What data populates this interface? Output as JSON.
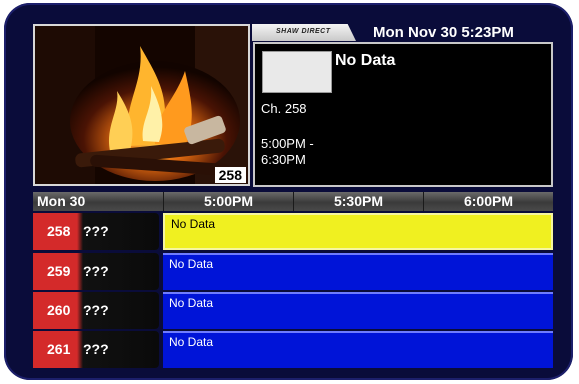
{
  "header": {
    "brand": "SHAW DIRECT",
    "clock": "Mon Nov 30 5:23PM"
  },
  "preview": {
    "channel_tag": "258"
  },
  "info": {
    "title": "No Data",
    "channel": "Ch. 258",
    "time_start": "5:00PM -",
    "time_end": "6:30PM"
  },
  "timebar": {
    "date": "Mon 30",
    "slots": [
      "5:00PM",
      "5:30PM",
      "6:00PM"
    ]
  },
  "rows": [
    {
      "channel": "258",
      "name": "???",
      "program": "No Data",
      "selected": true
    },
    {
      "channel": "259",
      "name": "???",
      "program": "No Data",
      "selected": false
    },
    {
      "channel": "260",
      "name": "???",
      "program": "No Data",
      "selected": false
    },
    {
      "channel": "261",
      "name": "???",
      "program": "No Data",
      "selected": false
    }
  ],
  "colors": {
    "selected": "#f0f020",
    "program_bg": "#0014d8",
    "channel_red": "#d42a2a"
  }
}
